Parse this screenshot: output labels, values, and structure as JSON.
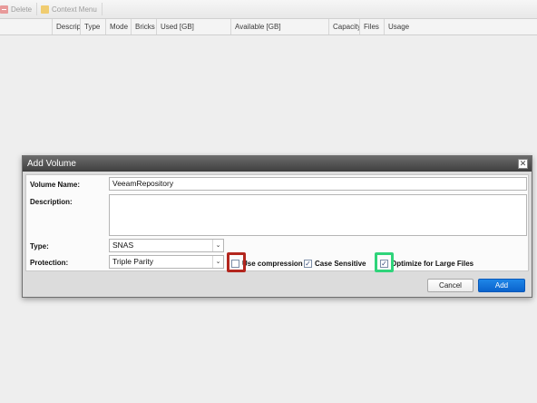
{
  "toolbar": {
    "delete_label": "Delete",
    "context_menu_label": "Context Menu"
  },
  "grid": {
    "columns": [
      "Descrip",
      "Type",
      "Mode",
      "Bricks",
      "Used [GB]",
      "Available [GB]",
      "Capacity",
      "Files",
      "Usage"
    ]
  },
  "dialog": {
    "title": "Add Volume",
    "close_glyph": "✕",
    "volume_name_label": "Volume Name:",
    "volume_name_value": "VeeamRepository",
    "description_label": "Description:",
    "description_value": "",
    "type_label": "Type:",
    "type_value": "SNAS",
    "protection_label": "Protection:",
    "protection_value": "Triple Parity",
    "dropdown_glyph": "⌄",
    "options": {
      "compression_label": "Use compression",
      "compression_checked": false,
      "case_sensitive_label": "Case Sensitive",
      "case_sensitive_checked": true,
      "optimize_label": "Optimize for Large Files",
      "optimize_checked": true
    },
    "check_glyph": "✓",
    "cancel_label": "Cancel",
    "add_label": "Add"
  },
  "colors": {
    "highlight_red": "#b3261e",
    "highlight_green": "#2fd47a",
    "primary_button": "#0a63cc"
  }
}
